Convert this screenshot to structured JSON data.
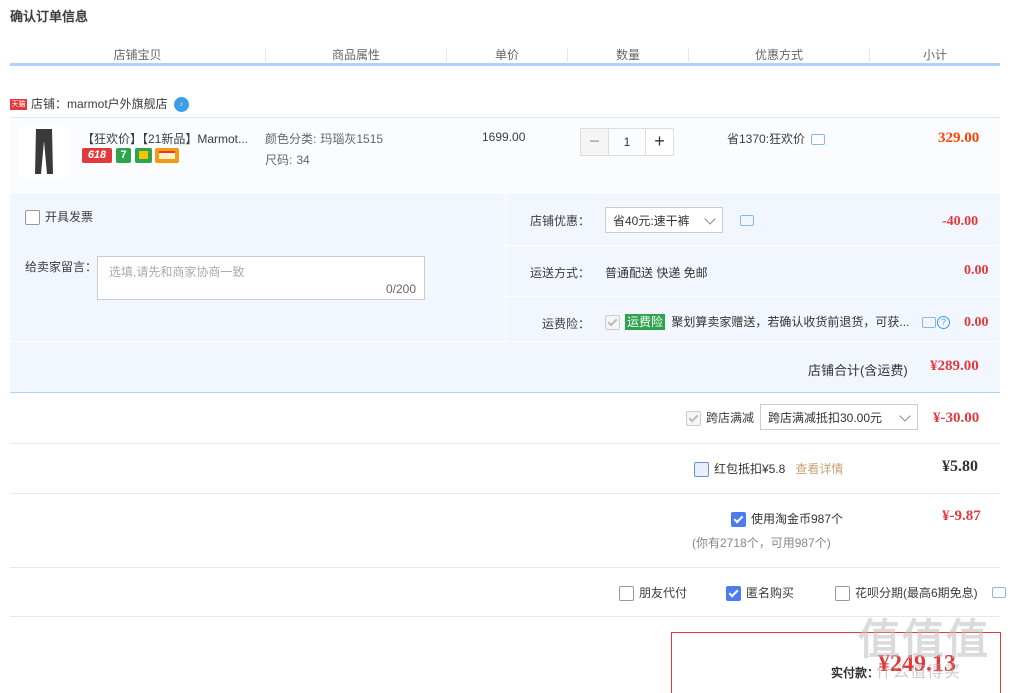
{
  "page_title": "确认订单信息",
  "columns": [
    "店铺宝贝",
    "商品属性",
    "单价",
    "数量",
    "优惠方式",
    "小计"
  ],
  "shop": {
    "tag": "天猫",
    "label": "店铺：",
    "name": "marmot户外旗舰店",
    "ww": "♪"
  },
  "item": {
    "name": "【狂欢价】【21新品】Marmot...",
    "badges": [
      "618",
      "7",
      "",
      "",
      ""
    ],
    "color_label": "颜色分类:",
    "color_value": "玛瑙灰1515",
    "size_label": "尺码:",
    "size_value": "34",
    "unit_price": "1699.00",
    "qty": "1",
    "qty_minus": "−",
    "qty_plus": "+",
    "discount": "省1370:狂欢价",
    "subtotal": "329.00"
  },
  "invoice_label": "开具发票",
  "message": {
    "label": "给卖家留言：",
    "placeholder": "选填,请先和商家协商一致",
    "counter": "0/200"
  },
  "shop_discount": {
    "label": "店铺优惠：",
    "selected": "省40元:速干裤",
    "value": "-40.00"
  },
  "shipping": {
    "label": "运送方式：",
    "text": "普通配送 快递 免邮",
    "value": "0.00"
  },
  "insurance": {
    "label": "运费险：",
    "tag": "运费险",
    "text": "聚划算卖家赠送，若确认收货前退货，可获...",
    "value": "0.00",
    "help": "?"
  },
  "shop_total": {
    "label": "店铺合计(含运费)",
    "value": "¥289.00"
  },
  "cross_shop": {
    "label": "跨店满减",
    "selected": "跨店满减抵扣30.00元",
    "value": "¥-30.00"
  },
  "redpacket": {
    "label": "红包抵扣¥5.8",
    "link": "查看详情",
    "value": "¥5.80"
  },
  "coins": {
    "label": "使用淘金币987个",
    "note": "(你有2718个，可用987个)",
    "value": "¥-9.87"
  },
  "options": {
    "friend_pay": "朋友代付",
    "anonymous": "匿名购买",
    "huabei": "花呗分期(最高6期免息)"
  },
  "pay": {
    "label": "实付款：",
    "value": "¥249.13"
  },
  "watermark": {
    "big": "值值值",
    "small": "什么值得买"
  },
  "colors": {
    "price_red": "#e4393c",
    "panel_blue": "#f2f7ff",
    "header_bar": "#b2d1ff",
    "check_blue": "#4d7cf0"
  }
}
